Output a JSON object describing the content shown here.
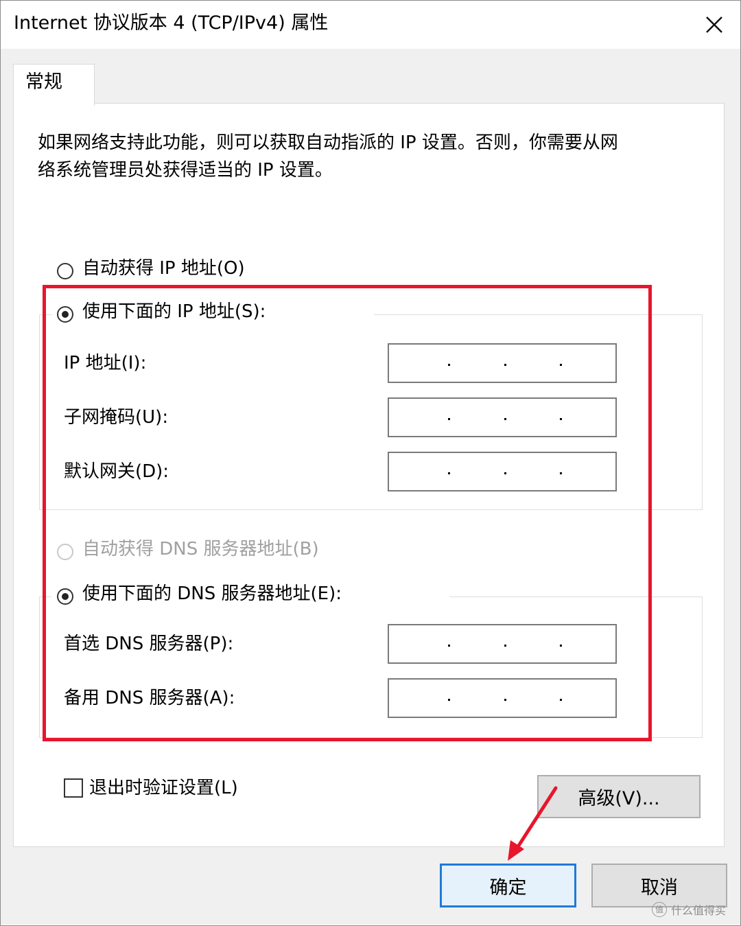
{
  "window": {
    "title": "Internet 协议版本 4 (TCP/IPv4) 属性",
    "close_glyph": "✕"
  },
  "tabs": [
    {
      "label": "常规",
      "selected": true
    }
  ],
  "description": "如果网络支持此功能，则可以获取自动指派的 IP 设置。否则，你需要从网\n络系统管理员处获得适当的 IP 设置。",
  "ip_section": {
    "auto_option": {
      "label": "自动获得 IP 地址(O)",
      "checked": false
    },
    "manual_option": {
      "label": "使用下面的 IP 地址(S):",
      "checked": true
    },
    "fields": [
      {
        "label": "IP 地址(I):",
        "value": ". . ."
      },
      {
        "label": "子网掩码(U):",
        "value": ". . ."
      },
      {
        "label": "默认网关(D):",
        "value": ". . ."
      }
    ]
  },
  "dns_section": {
    "auto_option": {
      "label": "自动获得 DNS 服务器地址(B)",
      "checked": false,
      "disabled": true
    },
    "manual_option": {
      "label": "使用下面的 DNS 服务器地址(E):",
      "checked": true
    },
    "fields": [
      {
        "label": "首选 DNS 服务器(P):",
        "value": ". . ."
      },
      {
        "label": "备用 DNS 服务器(A):",
        "value": ". . ."
      }
    ]
  },
  "validate_on_exit": {
    "label": "退出时验证设置(L)",
    "checked": false
  },
  "buttons": {
    "advanced": "高级(V)...",
    "ok": "确定",
    "cancel": "取消"
  },
  "watermark": {
    "badge": "值",
    "text": "什么值得买"
  },
  "colors": {
    "annotation_red": "#e8152c",
    "default_button_border": "#1e7ad6",
    "dialog_background": "#f0f0f0"
  }
}
